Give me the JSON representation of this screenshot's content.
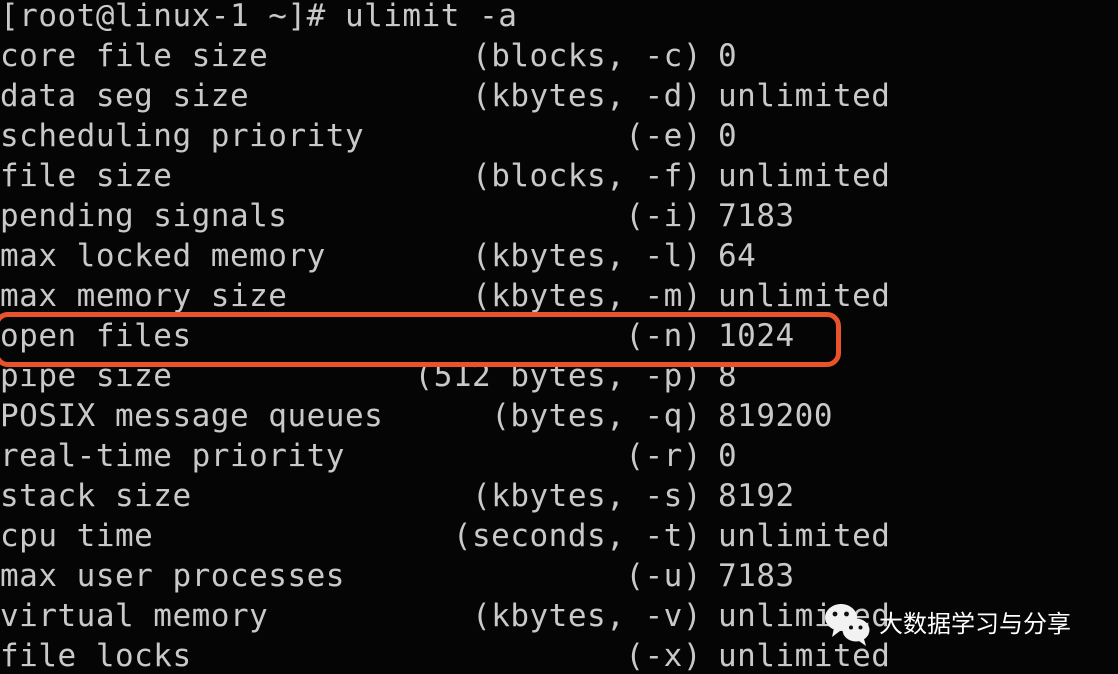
{
  "terminal": {
    "prompt_line": "[root@linux-1 ~]# ulimit -a",
    "rows": [
      {
        "name": "core file size",
        "unit": "(blocks, -c)",
        "value": "0"
      },
      {
        "name": "data seg size",
        "unit": "(kbytes, -d)",
        "value": "unlimited"
      },
      {
        "name": "scheduling priority",
        "unit": "(-e)",
        "value": "0"
      },
      {
        "name": "file size",
        "unit": "(blocks, -f)",
        "value": "unlimited"
      },
      {
        "name": "pending signals",
        "unit": "(-i)",
        "value": "7183"
      },
      {
        "name": "max locked memory",
        "unit": "(kbytes, -l)",
        "value": "64"
      },
      {
        "name": "max memory size",
        "unit": "(kbytes, -m)",
        "value": "unlimited"
      },
      {
        "name": "open files",
        "unit": "(-n)",
        "value": "1024"
      },
      {
        "name": "pipe size",
        "unit": "(512 bytes, -p)",
        "value": "8"
      },
      {
        "name": "POSIX message queues",
        "unit": "(bytes, -q)",
        "value": "819200"
      },
      {
        "name": "real-time priority",
        "unit": "(-r)",
        "value": "0"
      },
      {
        "name": "stack size",
        "unit": "(kbytes, -s)",
        "value": "8192"
      },
      {
        "name": "cpu time",
        "unit": "(seconds, -t)",
        "value": "unlimited"
      },
      {
        "name": "max user processes",
        "unit": "(-u)",
        "value": "7183"
      },
      {
        "name": "virtual memory",
        "unit": "(kbytes, -v)",
        "value": "unlimited"
      },
      {
        "name": "file locks",
        "unit": "(-x)",
        "value": "unlimited"
      }
    ],
    "colors": {
      "background": "#050505",
      "foreground": "#c9c9c9"
    }
  },
  "annotation": {
    "highlight_row": "open files",
    "color": "#e8532c"
  },
  "watermark": {
    "icon": "wechat-logo-icon",
    "text": "大数据学习与分享"
  }
}
